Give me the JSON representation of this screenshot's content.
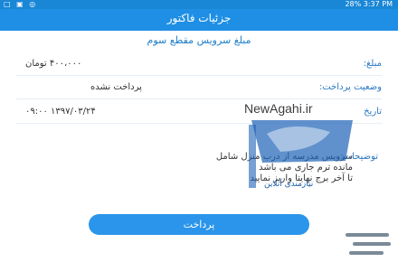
{
  "status_bar": {
    "time": "3:37 PM",
    "battery": "28%",
    "left_icons": "□ ▣ ◎"
  },
  "app_bar": {
    "title": "جزئیات فاکتور"
  },
  "subtitle": "مبلغ سرویس مقطع سوم",
  "rows": [
    {
      "label": "مبلغ:",
      "value": "۴۰۰،۰۰۰ تومان"
    },
    {
      "label": "وضعیت پرداخت:",
      "value": "پرداخت نشده"
    },
    {
      "label": "تاریخ",
      "value": "۱۳۹۷/۰۳/۲۴ ۰۹:۰۰"
    }
  ],
  "note": {
    "label": "توضیحات:",
    "lines": [
      "سرویس مدرسه از درب منزل شامل",
      "مانده ترم جاری می باشد",
      "تا آخر برج نهایتا واریز نمایید"
    ]
  },
  "pay_button": {
    "label": "پرداخت"
  },
  "watermark": {
    "url": "NewAgahi.ir",
    "tagline": "نیازمندی آنلاین"
  },
  "colors": {
    "primary": "#1f8fe5",
    "label": "#2b78c3",
    "button": "#2a95ea"
  }
}
